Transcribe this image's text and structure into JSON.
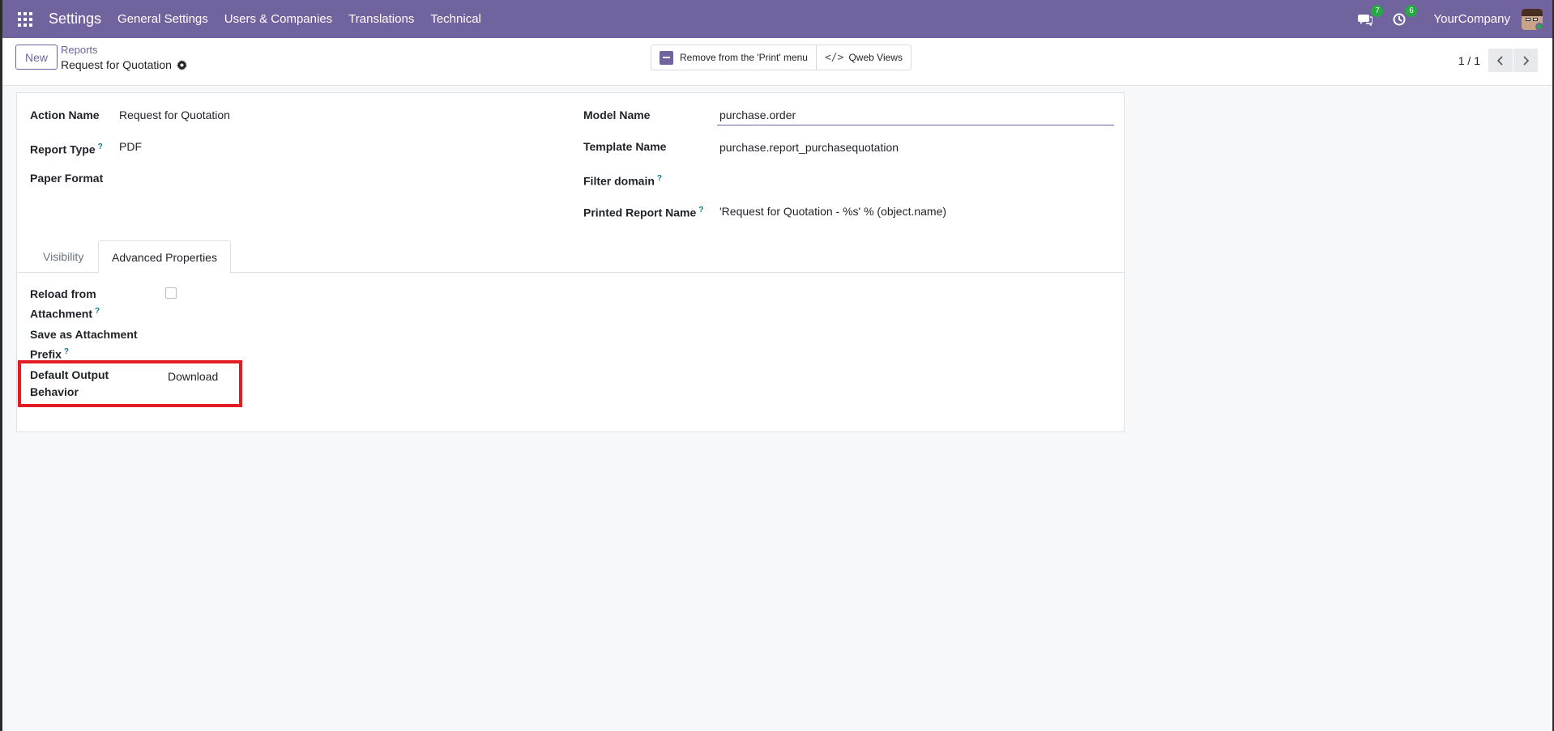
{
  "navbar": {
    "brand": "Settings",
    "menu": [
      "General Settings",
      "Users & Companies",
      "Translations",
      "Technical"
    ],
    "messages_badge": "7",
    "activities_badge": "6",
    "company": "YourCompany"
  },
  "control_panel": {
    "new_label": "New",
    "breadcrumb_parent": "Reports",
    "breadcrumb_current": "Request for Quotation",
    "remove_print_label": "Remove from the 'Print' menu",
    "qweb_views_label": "Qweb Views",
    "pager": "1 / 1"
  },
  "form": {
    "left": [
      {
        "label": "Action Name",
        "help": false,
        "value": "Request for Quotation"
      },
      {
        "label": "Report Type",
        "help": true,
        "value": "PDF"
      },
      {
        "label": "Paper Format",
        "help": false,
        "value": ""
      }
    ],
    "right": [
      {
        "label": "Model Name",
        "help": false,
        "value": "purchase.order"
      },
      {
        "label": "Template Name",
        "help": false,
        "value": "purchase.report_purchasequotation"
      },
      {
        "label": "Filter domain",
        "help": true,
        "value": ""
      },
      {
        "label": "Printed Report Name",
        "help": true,
        "value": "'Request for Quotation - %s' % (object.name)"
      }
    ],
    "help_mark": "?"
  },
  "tabs": [
    "Visibility",
    "Advanced Properties"
  ],
  "advanced": {
    "reload_label_1": "Reload from",
    "reload_label_2": "Attachment",
    "reload_checked": false,
    "prefix_label_1": "Save as Attachment",
    "prefix_label_2": "Prefix",
    "output_label_1": "Default Output",
    "output_label_2": "Behavior",
    "output_value": "Download"
  },
  "colors": {
    "brand": "#71639e",
    "badge": "#28a745",
    "help": "#017e84",
    "highlight": "#e31b23"
  }
}
